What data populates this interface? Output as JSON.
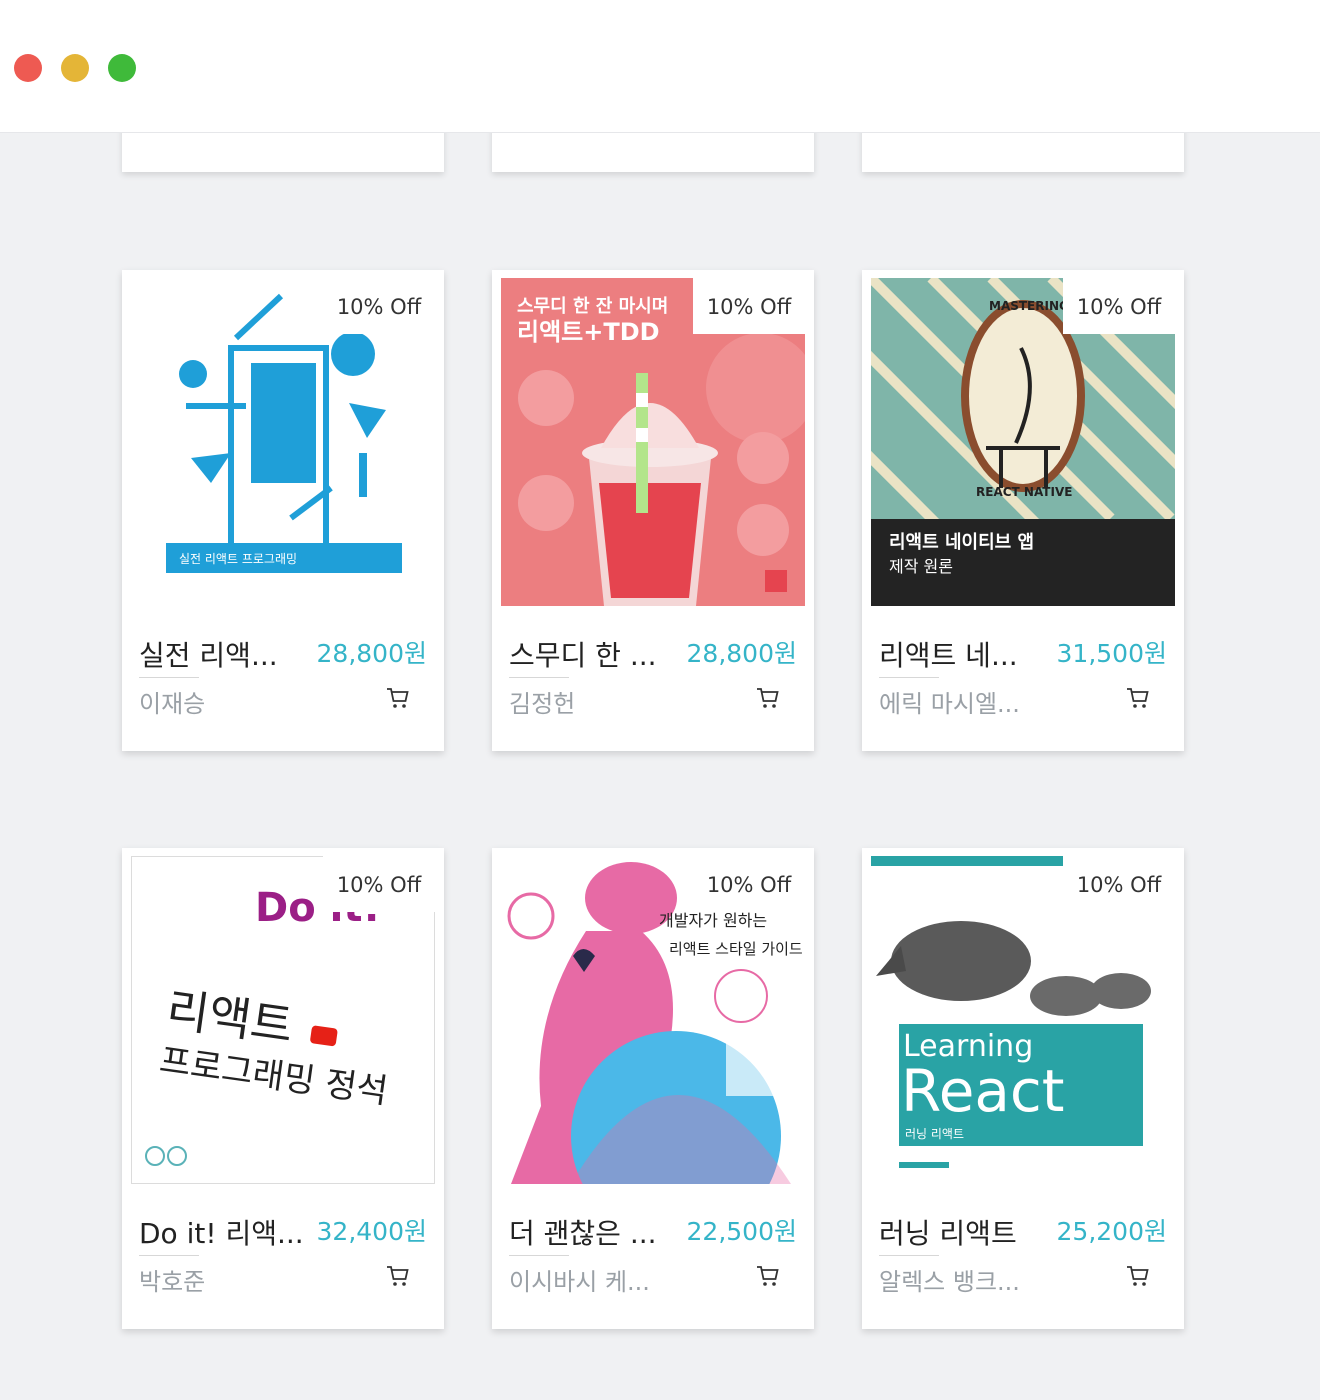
{
  "window": {
    "controls": [
      "close",
      "minimize",
      "maximize"
    ],
    "colors": {
      "close": "#ee5a52",
      "minimize": "#e4b537",
      "maximize": "#3fba3a"
    }
  },
  "theme": {
    "accent": "#35b4c8",
    "background": "#f0f1f3"
  },
  "products": [
    {
      "badge": "10% Off",
      "title": "실전 리액...",
      "price": "28,800원",
      "author": "이재승",
      "cover": {
        "text": "실전 리액트 프로그래밍"
      }
    },
    {
      "badge": "10% Off",
      "title": "스무디 한 ...",
      "price": "28,800원",
      "author": "김정헌",
      "cover": {
        "text": "스무디 한 잔 마시며",
        "text2": "리액트+TDD"
      }
    },
    {
      "badge": "10% Off",
      "title": "리액트 네...",
      "price": "31,500원",
      "author": "에릭 마시엘...",
      "cover": {
        "text": "MASTERING",
        "text2": "REACT NATIVE",
        "text3": "리액트 네이티브 앱",
        "text4": "제작 원론"
      }
    },
    {
      "badge": "10% Off",
      "title": "Do it! 리액...",
      "price": "32,400원",
      "author": "박호준",
      "cover": {
        "text": "Do it!",
        "text2": "리액트",
        "text3": "프로그래밍 정석"
      }
    },
    {
      "badge": "10% Off",
      "title": "더 괜찮은 ...",
      "price": "22,500원",
      "author": "이시바시 케...",
      "cover": {
        "text": "개발자가 원하는",
        "text2": "리액트 스타일 가이드"
      }
    },
    {
      "badge": "10% Off",
      "title": "러닝 리액트",
      "price": "25,200원",
      "author": "알렉스 뱅크...",
      "cover": {
        "text": "Learning",
        "text2": "React",
        "text3": "러닝 리액트"
      }
    }
  ],
  "icons": {
    "cart": "cart-icon"
  }
}
